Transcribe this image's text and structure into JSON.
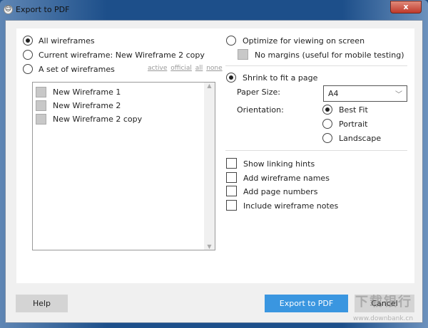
{
  "window": {
    "title": "Export to PDF",
    "close": "x"
  },
  "left": {
    "all_wireframes": "All wireframes",
    "current_wireframe": "Current wireframe: New Wireframe 2 copy",
    "set_of_wireframes": "A set of wireframes",
    "filters": [
      "active",
      "official",
      "all",
      "none"
    ],
    "items": [
      "New Wireframe 1",
      "New Wireframe 2",
      "New Wireframe 2 copy"
    ],
    "selected": "All wireframes"
  },
  "right": {
    "optimize": "Optimize for viewing on screen",
    "no_margins": "No margins (useful for mobile testing)",
    "shrink": "Shrink to fit a page",
    "paper_size_label": "Paper Size:",
    "paper_size": "A4",
    "orientation_label": "Orientation:",
    "orientations": [
      "Best Fit",
      "Portrait",
      "Landscape"
    ],
    "orientation_selected": "Best Fit",
    "options": [
      "Show linking hints",
      "Add wireframe names",
      "Add page numbers",
      "Include wireframe notes"
    ]
  },
  "buttons": {
    "help": "Help",
    "export": "Export to PDF",
    "cancel": "Cancel"
  },
  "watermark": {
    "cn": "下载银行",
    "url": "www.downbank.cn"
  },
  "colors": {
    "accent": "#3a96e0",
    "titlebar": "#1d4f8a"
  }
}
